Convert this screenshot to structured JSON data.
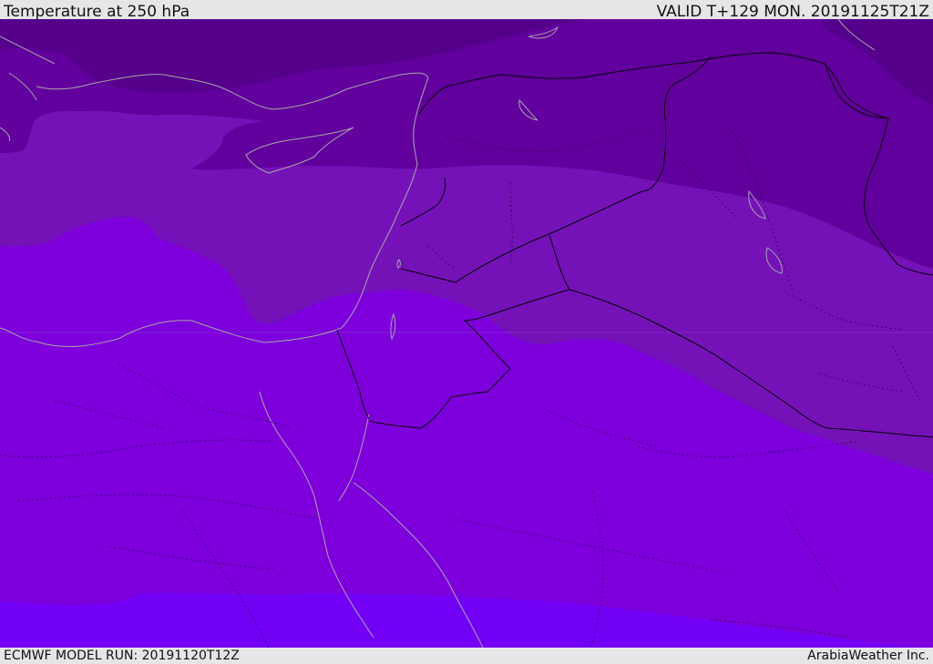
{
  "header": {
    "title": "Temperature at 250 hPa",
    "valid": "VALID T+129 MON. 20191125T21Z"
  },
  "footer": {
    "model_run": "ECMWF MODEL RUN: 20191120T12Z",
    "credit": "ArabiaWeather Inc."
  },
  "map": {
    "colors": {
      "band_darkest": "#54008a",
      "band_dark": "#62009e",
      "band_mid": "#7412b8",
      "band_main": "#7d00dc",
      "band_light": "#7200f5",
      "coast": "#a6a6a6",
      "border": "#000000"
    }
  }
}
